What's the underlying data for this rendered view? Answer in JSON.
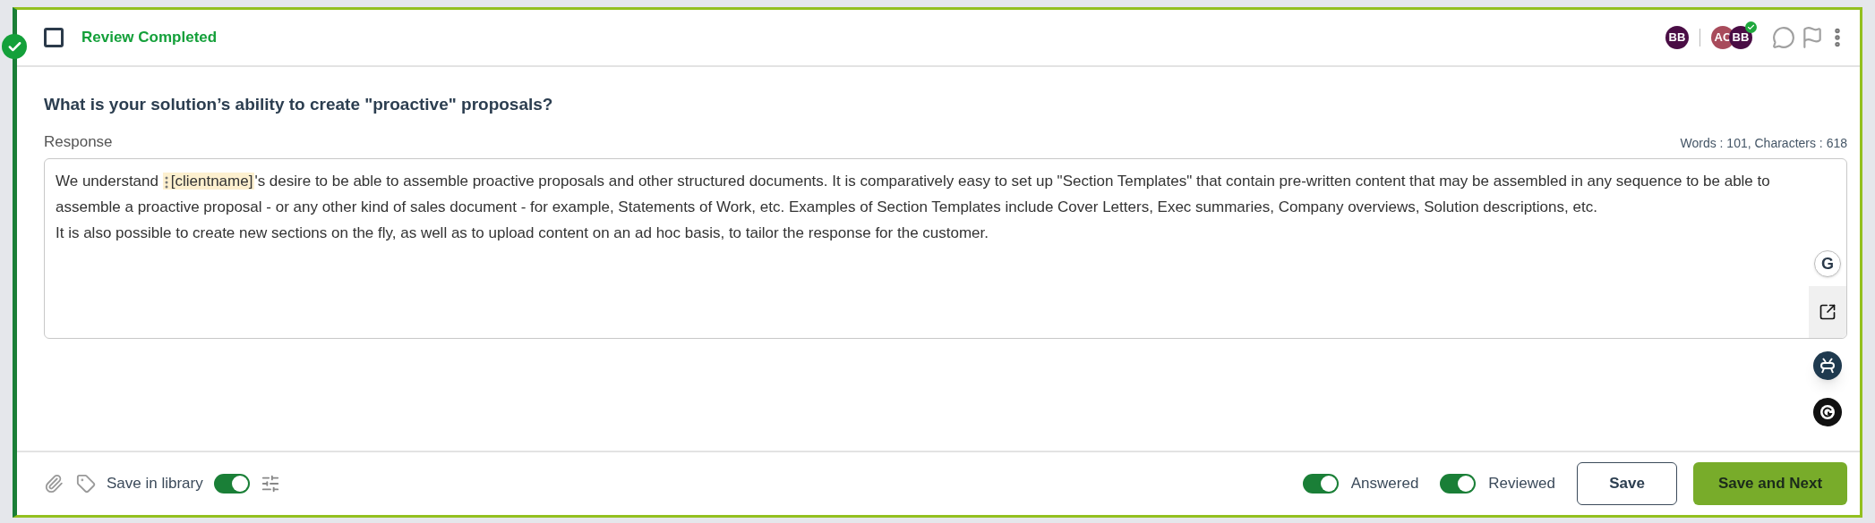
{
  "status": {
    "completed": true,
    "checked": false,
    "label": "Review Completed"
  },
  "header": {
    "assignees": [
      {
        "initials": "BB",
        "color": "#4a0d45"
      }
    ],
    "reviewers": [
      {
        "initials": "AC",
        "color": "#a84b5b",
        "approved": false
      },
      {
        "initials": "BB",
        "color": "#4a0d45",
        "approved": true
      }
    ]
  },
  "question": "What is your solution’s ability to create \"proactive\" proposals?",
  "response": {
    "label": "Response",
    "grammar_badge": "G",
    "counts": "Words : 101, Characters : 618",
    "paragraphs": [
      {
        "parts": [
          {
            "kind": "text",
            "text": "We understand "
          },
          {
            "kind": "token",
            "text": "[clientname]"
          },
          {
            "kind": "text",
            "text": "'s desire to be able to assemble proactive proposals and other structured documents. It is comparatively easy to set up \"Section Templates\" that contain pre-written content that may be assembled in any sequence to be able to assemble a proactive proposal - or any other kind of sales document - for example, Statements of Work, etc. Examples of Section Templates include Cover Letters, Exec summaries, Company overviews, Solution descriptions, etc."
          }
        ]
      },
      {
        "parts": [
          {
            "kind": "text",
            "text": "It is also possible to create new sections on the fly, as well as to upload content on an ad hoc basis, to tailor the response for the customer."
          }
        ]
      }
    ]
  },
  "footer": {
    "save_in_library": {
      "label": "Save in library",
      "on": true
    },
    "toggles": [
      {
        "label": "Answered",
        "on": true
      },
      {
        "label": "Reviewed",
        "on": true
      }
    ],
    "buttons": [
      {
        "label": "Save",
        "kind": "secondary"
      },
      {
        "label": "Save and Next",
        "kind": "primary"
      }
    ]
  }
}
